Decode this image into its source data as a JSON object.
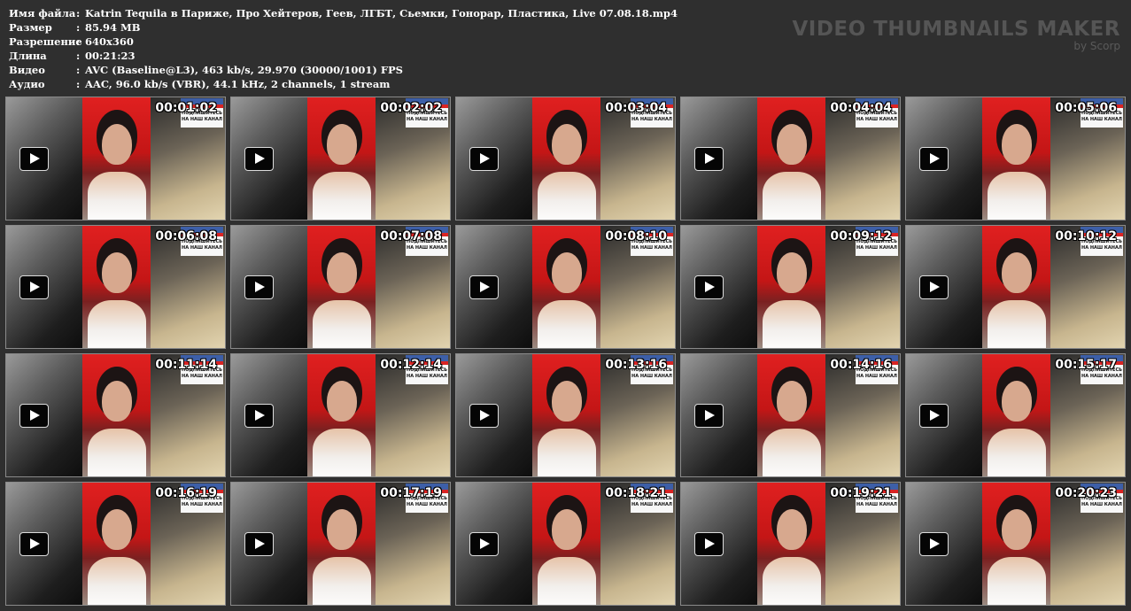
{
  "file_info": [
    {
      "label": "Имя файла",
      "sep": ":",
      "value": "Katrin Tequila в Париже, Про Хейтеров, Геев, ЛГБТ, Сьемки, Гонорар, Пластика, Live 07.08.18.mp4"
    },
    {
      "label": "Размер",
      "sep": ":",
      "value": "85.94 MB"
    },
    {
      "label": "Разрешение",
      "sep": ":",
      "value": "640x360"
    },
    {
      "label": "Длина",
      "sep": ":",
      "value": "00:21:23"
    },
    {
      "label": "Видео",
      "sep": ":",
      "value": "AVC (Baseline@L3), 463 kb/s, 29.970 (30000/1001) FPS"
    },
    {
      "label": "Аудио",
      "sep": ":",
      "value": "AAC, 96.0 kb/s (VBR), 44.1 kHz, 2 channels, 1 stream"
    }
  ],
  "brand": {
    "title": "VIDEO THUMBNAILS MAKER",
    "subtitle": "by Scorp"
  },
  "badge_text": "ПОДПИШИТЕСЬ НА НАШ КАНАЛ",
  "thumbnails": [
    {
      "time": "00:01:02"
    },
    {
      "time": "00:02:02"
    },
    {
      "time": "00:03:04"
    },
    {
      "time": "00:04:04"
    },
    {
      "time": "00:05:06"
    },
    {
      "time": "00:06:08"
    },
    {
      "time": "00:07:08"
    },
    {
      "time": "00:08:10"
    },
    {
      "time": "00:09:12"
    },
    {
      "time": "00:10:12"
    },
    {
      "time": "00:11:14"
    },
    {
      "time": "00:12:14"
    },
    {
      "time": "00:13:16"
    },
    {
      "time": "00:14:16"
    },
    {
      "time": "00:15:17"
    },
    {
      "time": "00:16:19"
    },
    {
      "time": "00:17:19"
    },
    {
      "time": "00:18:21"
    },
    {
      "time": "00:19:21"
    },
    {
      "time": "00:20:23"
    }
  ]
}
